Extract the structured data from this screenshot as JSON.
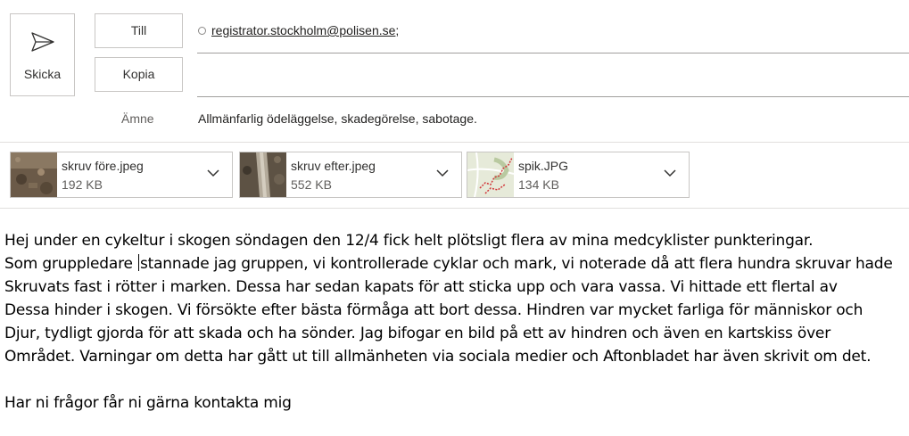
{
  "compose": {
    "send_label": "Skicka",
    "to_label": "Till",
    "cc_label": "Kopia",
    "subject_label": "Ämne",
    "to_recipient": "registrator.stockholm@polisen.se",
    "to_separator": ";",
    "subject": "Allmänfarlig ödeläggelse, skadegörelse, sabotage."
  },
  "attachments": [
    {
      "name": "skruv före.jpeg",
      "size": "192 KB",
      "icon": "image-thumbnail"
    },
    {
      "name": "skruv efter.jpeg",
      "size": "552 KB",
      "icon": "image-thumbnail"
    },
    {
      "name": "spik.JPG",
      "size": "134 KB",
      "icon": "map-thumbnail"
    }
  ],
  "body": {
    "line1": "Hej under en cykeltur i skogen söndagen den 12/4 fick helt plötsligt flera av mina medcyklister punkteringar.",
    "line2a": "Som gruppledare ",
    "line2b": "stannade jag gruppen, vi kontrollerade cyklar och mark, vi noterade då att flera hundra skruvar hade",
    "line3": "Skruvats fast i rötter i marken. Dessa har sedan kapats för att sticka upp och vara vassa. Vi hittade ett flertal av",
    "line4": "Dessa hinder i skogen. Vi försökte efter bästa förmåga att bort dessa. Hindren var mycket farliga för människor och",
    "line5": "Djur, tydligt gjorda för att skada och ha sönder. Jag bifogar en bild på ett av hindren och även en kartskiss över",
    "line6": "Området. Varningar om detta har gått ut till allmänheten via sociala medier och Aftonbladet har även skrivit om det.",
    "line7": "",
    "line8": "Har ni frågor får ni gärna kontakta mig"
  },
  "colors": {
    "border": "#c8c6c4",
    "line": "#a19f9d",
    "map_route": "#d13438"
  }
}
